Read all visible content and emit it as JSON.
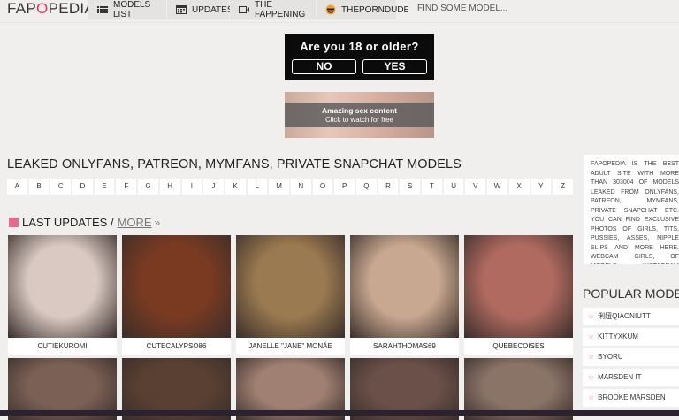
{
  "brand": {
    "logo_before": "FAP",
    "logo_o": "O",
    "logo_after": "PEDIA"
  },
  "nav": [
    {
      "label": "MODELS LIST",
      "icon": "list-icon"
    },
    {
      "label": "UPDATES",
      "icon": "calendar-icon"
    },
    {
      "label": "THE FAPPENING",
      "icon": "video-icon"
    },
    {
      "label": "THEPORNDUDE",
      "icon": "dude-icon"
    }
  ],
  "search": {
    "placeholder": "FIND SOME MODEL..."
  },
  "age_gate": {
    "question": "Are you 18 or older?",
    "no": "NO",
    "yes": "YES"
  },
  "ad": {
    "line1": "Amazing sex content",
    "line2": "Click to watch for free"
  },
  "heading": "LEAKED ONLYFANS, PATREON, MYMFANS, PRIVATE SNAPCHAT MODELS",
  "alphabet": [
    "A",
    "B",
    "C",
    "D",
    "E",
    "F",
    "G",
    "H",
    "I",
    "J",
    "K",
    "L",
    "M",
    "N",
    "O",
    "P",
    "Q",
    "R",
    "S",
    "T",
    "U",
    "V",
    "W",
    "X",
    "Y",
    "Z"
  ],
  "last_updates": {
    "title": "LAST UPDATES /",
    "more": "MORE"
  },
  "models": [
    {
      "name": "CUTIEKUROMI",
      "color": "#d9c9c2"
    },
    {
      "name": "CUTECALYPSO86",
      "color": "#7a3a22"
    },
    {
      "name": "JANELLE \"JANE\" MONÁE",
      "color": "#9a7a50"
    },
    {
      "name": "SARAHTHOMAS69",
      "color": "#c8a890"
    },
    {
      "name": "QUEBECOISES",
      "color": "#b06a60"
    }
  ],
  "second_row_colors": [
    "#7a6055",
    "#5a4032",
    "#a08072",
    "#6a5048",
    "#8a7468"
  ],
  "about": "FAPOPEDIA IS THE BEST ADULT SITE WITH MORE THAN 303004 OF MODELS LEAKED FROM ONLYFANS, PATREON, MYMFANS, PRIVATE SNAPCHAT ETC. YOU CAN FIND EXCLUSIVE PHOTOS OF GIRLS, TITS, PUSSIES, ASSES, NIPPLE SLIPS AND MORE HERE. WEBCAM GIRLS, OF MODELS, INSTAGRAM FAMOUS, PORNSTARS AND CELEBRITIES WITH DAILY UPDATES AND ENJOY FOR FREE",
  "popular": {
    "title": "POPULAR MODELS",
    "items": [
      "俐妞QIAONIUTT",
      "KITTYXKUM",
      "BYORU",
      "MARSDEN IT",
      "BROOKE MARSDEN"
    ]
  }
}
